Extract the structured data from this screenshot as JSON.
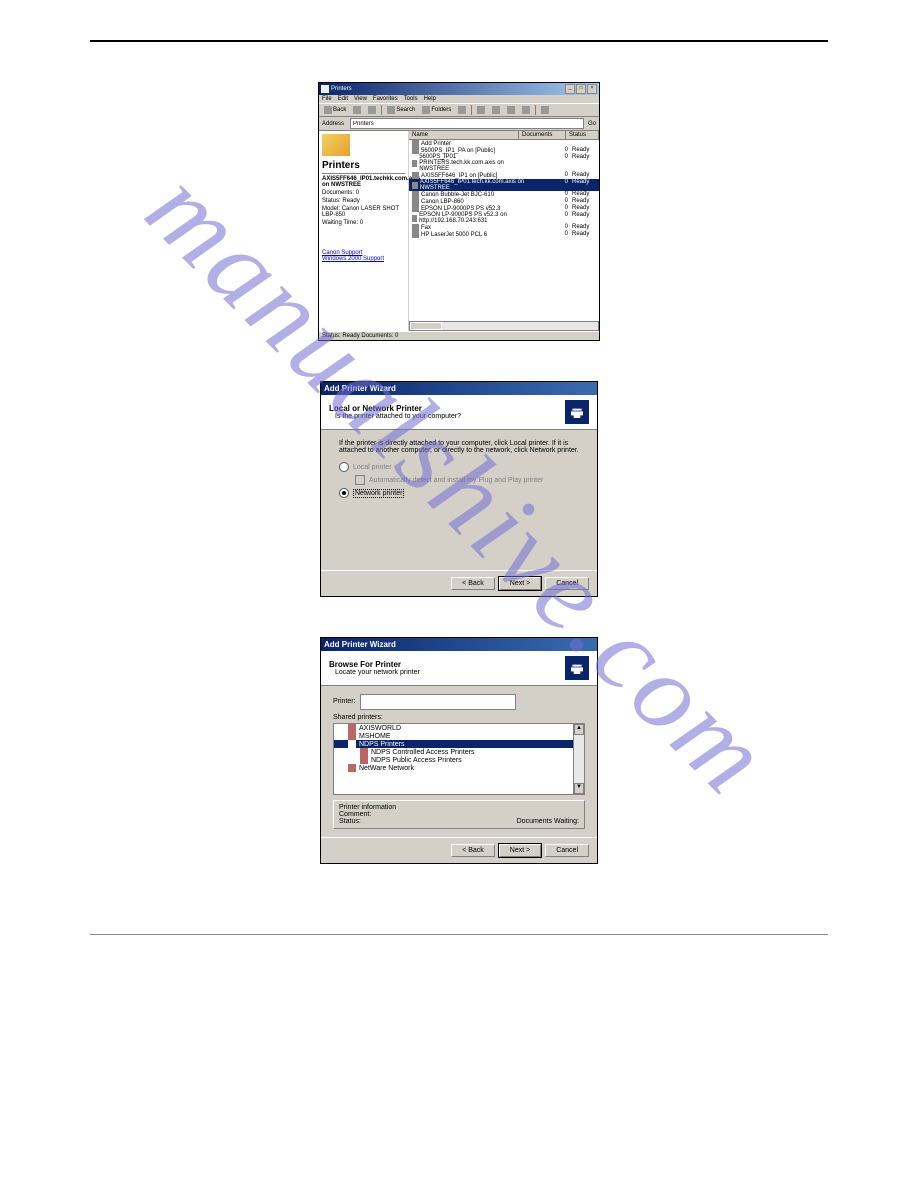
{
  "watermark": "manualshive.com",
  "printers_window": {
    "title": "Printers",
    "menus": [
      "File",
      "Edit",
      "View",
      "Favorites",
      "Tools",
      "Help"
    ],
    "toolbar": {
      "back": "Back",
      "search": "Search",
      "folders": "Folders"
    },
    "address": {
      "label": "Address",
      "value": "Printers",
      "go": "Go"
    },
    "side": {
      "heading": "Printers",
      "selected_name": "AXIS5FF646_IP01.techkk.com.axis on NWSTREE",
      "documents_label": "Documents:",
      "documents_value": "0",
      "status_label": "Status:",
      "status_value": "Ready",
      "model_label": "Model:",
      "model_value": "Canon LASER SHOT LBP-850",
      "waiting_label": "Waiting Time:",
      "waiting_value": "0",
      "link1": "Canon Support",
      "link2": "Windows 2000 Support"
    },
    "columns": {
      "name": "Name",
      "documents": "Documents",
      "status": "Status"
    },
    "rows": [
      {
        "name": "Add Printer",
        "documents": "",
        "status": ""
      },
      {
        "name": "5600PS_IP1_PA on [Public]",
        "documents": "0",
        "status": "Ready"
      },
      {
        "name": "5600PS_IP01 PRINTERS.tech.kk.com.axis on NWSTREE",
        "documents": "0",
        "status": "Ready"
      },
      {
        "name": "AXIS5FF646_IP1 on [Public]",
        "documents": "0",
        "status": "Ready"
      },
      {
        "name": "AXIS5FF646_IP01.tech.kk.com.axis on NWSTREE",
        "documents": "0",
        "status": "Ready",
        "selected": true
      },
      {
        "name": "Canon Bubble-Jet BJC-610",
        "documents": "0",
        "status": "Ready"
      },
      {
        "name": "Canon LBP-860",
        "documents": "0",
        "status": "Ready"
      },
      {
        "name": "EPSON LP-9000PS PS v52.3",
        "documents": "0",
        "status": "Ready"
      },
      {
        "name": "EPSON LP-9000PS PS v52.3 on http://192.168.70.243:631",
        "documents": "0",
        "status": "Ready"
      },
      {
        "name": "Fax",
        "documents": "0",
        "status": "Ready"
      },
      {
        "name": "HP LaserJet 5000 PCL 6",
        "documents": "0",
        "status": "Ready"
      }
    ],
    "statusbar": "Status: Ready  Documents: 0"
  },
  "wizard1": {
    "title": "Add Printer Wizard",
    "header1": "Local or Network Printer",
    "header2": "Is the printer attached to your computer?",
    "message": "If the printer is directly attached to your computer, click Local printer. If it is attached to another computer, or directly to the network, click Network printer.",
    "opt_local": "Local printer",
    "opt_auto": "Automatically detect and install my Plug and Play printer",
    "opt_network": "Network printer",
    "buttons": {
      "back": "< Back",
      "next": "Next >",
      "cancel": "Cancel"
    }
  },
  "wizard2": {
    "title": "Add Printer Wizard",
    "header1": "Browse For Printer",
    "header2": "Locate your network printer",
    "printer_label": "Printer:",
    "printer_value": "",
    "shared_label": "Shared printers:",
    "tree": [
      {
        "label": "AXISWORLD",
        "indent": 1
      },
      {
        "label": "MSHOME",
        "indent": 1
      },
      {
        "label": "NDPS Printers",
        "indent": 1,
        "selected": true
      },
      {
        "label": "NDPS Controlled Access Printers",
        "indent": 2
      },
      {
        "label": "NDPS Public Access Printers",
        "indent": 2
      },
      {
        "label": "NetWare Network",
        "indent": 1
      }
    ],
    "info": {
      "heading": "Printer information",
      "comment_label": "Comment:",
      "comment_value": "",
      "status_label": "Status:",
      "status_value": "",
      "docs_label": "Documents Waiting:",
      "docs_value": ""
    },
    "buttons": {
      "back": "< Back",
      "next": "Next >",
      "cancel": "Cancel"
    }
  }
}
